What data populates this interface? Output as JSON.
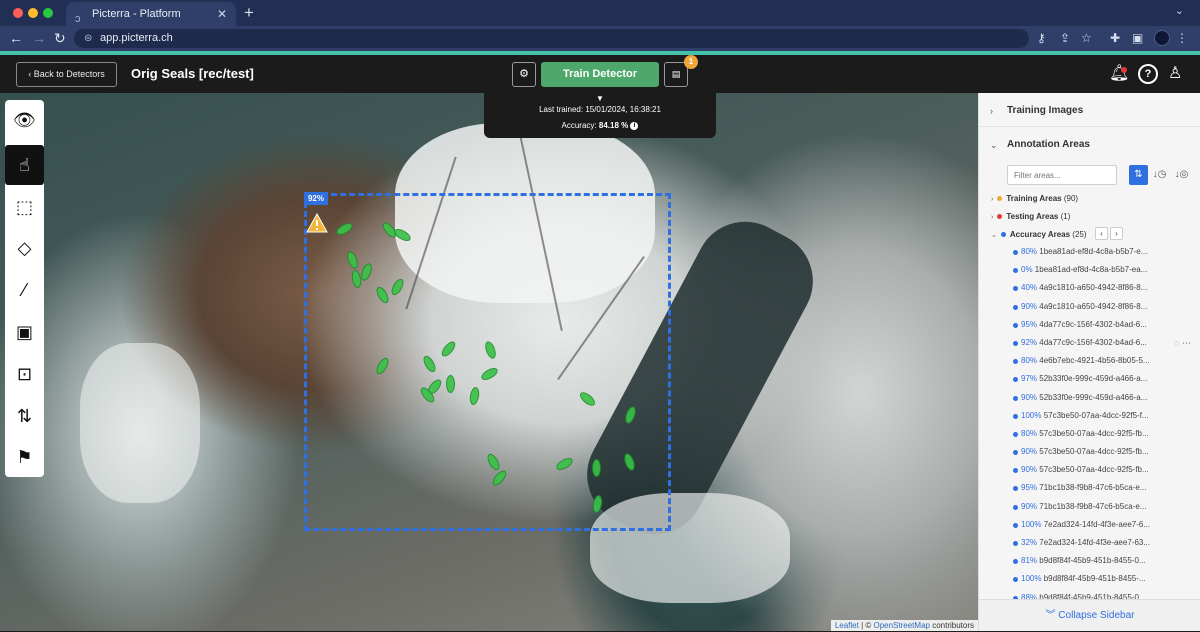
{
  "browser": {
    "tab_title": "Picterra - Platform",
    "url": "app.picterra.ch"
  },
  "header": {
    "back_label": "Back to Detectors",
    "detector_title": "Orig Seals [rec/test]",
    "train_label": "Train Detector",
    "queue_badge": "1"
  },
  "train_popover": {
    "last_trained": "Last trained: 15/01/2024, 16:38:21",
    "accuracy_label": "Accuracy:",
    "accuracy_value": "84.18 %"
  },
  "map": {
    "aoi_score": "92%",
    "attribution_leaflet": "Leaflet",
    "attribution_sep": " | © ",
    "attribution_osm": "OpenStreetMap",
    "attribution_tail": " contributors"
  },
  "toolbar": {
    "tools": [
      "eye-icon",
      "hand-icon",
      "rectangle-select-icon",
      "polygon-icon",
      "magic-wand-icon",
      "frame-icon",
      "zoom-area-icon",
      "swap-icon",
      "flag-icon"
    ],
    "active_index": 1
  },
  "sidebar": {
    "training_images": "Training Images",
    "annotation_areas": "Annotation Areas",
    "filter_placeholder": "Filter areas...",
    "groups": {
      "training": {
        "label": "Training Areas",
        "count": "(90)",
        "color": "#f0a63a"
      },
      "testing": {
        "label": "Testing Areas",
        "count": "(1)",
        "color": "#e53935"
      },
      "accuracy": {
        "label": "Accuracy Areas",
        "count": "(25)",
        "color": "#2f6fe0"
      }
    },
    "areas": [
      {
        "pct": "80%",
        "id": "1bea81ad-ef8d-4c8a-b5b7-e..."
      },
      {
        "pct": "0%",
        "id": "1bea81ad-ef8d-4c8a-b5b7-ea..."
      },
      {
        "pct": "40%",
        "id": "4a9c1810-a650-4942-8f86-8..."
      },
      {
        "pct": "90%",
        "id": "4a9c1810-a650-4942-8f86-8..."
      },
      {
        "pct": "95%",
        "id": "4da77c9c-156f-4302-b4ad-6..."
      },
      {
        "pct": "92%",
        "id": "4da77c9c-156f-4302-b4ad-6..."
      },
      {
        "pct": "80%",
        "id": "4e6b7ebc-4921-4b56-8b05-5..."
      },
      {
        "pct": "97%",
        "id": "52b33f0e-999c-459d-a466-a..."
      },
      {
        "pct": "90%",
        "id": "52b33f0e-999c-459d-a466-a..."
      },
      {
        "pct": "100%",
        "id": "57c3be50-07aa-4dcc-92f5-f..."
      },
      {
        "pct": "80%",
        "id": "57c3be50-07aa-4dcc-92f5-fb..."
      },
      {
        "pct": "90%",
        "id": "57c3be50-07aa-4dcc-92f5-fb..."
      },
      {
        "pct": "90%",
        "id": "57c3be50-07aa-4dcc-92f5-fb..."
      },
      {
        "pct": "95%",
        "id": "71bc1b38-f9b8-47c6-b5ca-e..."
      },
      {
        "pct": "90%",
        "id": "71bc1b38-f9b8-47c6-b5ca-e..."
      },
      {
        "pct": "100%",
        "id": "7e2ad324-14fd-4f3e-aee7-6..."
      },
      {
        "pct": "32%",
        "id": "7e2ad324-14fd-4f3e-aee7-63..."
      },
      {
        "pct": "81%",
        "id": "b9d8f84f-45b9-451b-8455-0..."
      },
      {
        "pct": "100%",
        "id": "b9d8f84f-45b9-451b-8455-..."
      },
      {
        "pct": "88%",
        "id": "b9d8f84f-45b9-451b-8455-0..."
      }
    ],
    "collapse_label": "Collapse Sidebar"
  },
  "colors": {
    "accent": "#2f6fe0",
    "train_green": "#4ea86b",
    "seal_green": "#39c247"
  }
}
